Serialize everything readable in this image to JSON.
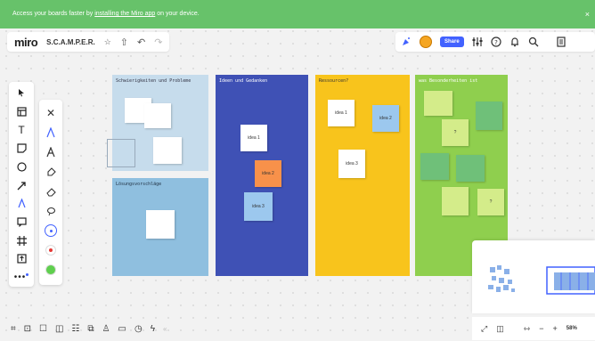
{
  "banner": {
    "text_prefix": "Access your boards faster by ",
    "link_text": "installing the Miro app",
    "text_suffix": " on your device.",
    "close": "×"
  },
  "topbar": {
    "logo": "miro",
    "board_title": "S.C.A.M.P.E.R.",
    "star_icon": "☆",
    "export_icon": "⇧",
    "undo_icon": "↶",
    "redo_icon": "↷",
    "share_label": "Share"
  },
  "toolbar": {
    "tools": [
      "select",
      "templates",
      "text",
      "sticky-note",
      "shapes",
      "arrow",
      "pen",
      "comment",
      "frame",
      "upload",
      "more"
    ]
  },
  "frames": {
    "f1_title": "Schwierigkeiten und Probleme",
    "f2_title": "Lösungsvorschläge",
    "f3_title": "Ideen und Gedanken",
    "f4_title": "Ressourcen?",
    "f5_title": "was Besonderheiten ist",
    "notes": {
      "idea1_blue": "idea 1",
      "idea2_blue": "idea 2",
      "idea3_blue": "idea 3",
      "idea1_yellow": "idea 1",
      "idea2_yellow": "idea 2",
      "idea3_yellow": "idea 3",
      "q1": "?",
      "q2": "?"
    }
  },
  "zoom": {
    "level": "58%"
  },
  "colors": {
    "banner": "#67c26a",
    "frame_lightblue": "#c6dcec",
    "frame_blue": "#3f51b5",
    "frame_yellow": "#f8c41c",
    "frame_green": "#8fcf4e",
    "accent": "#4262ff"
  }
}
